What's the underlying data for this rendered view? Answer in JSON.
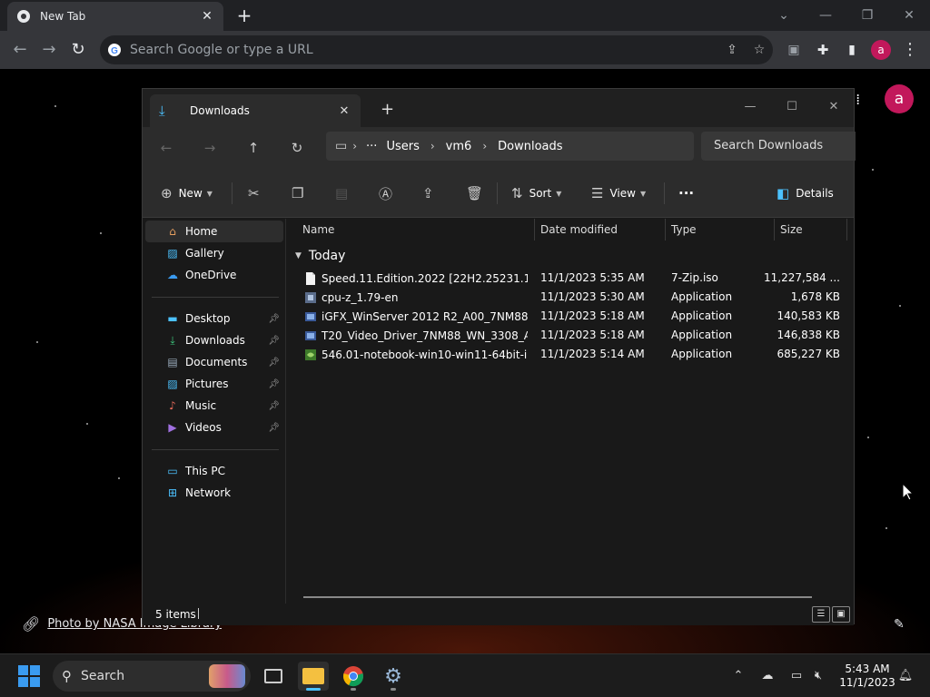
{
  "browser": {
    "tab_title": "New Tab",
    "omnibox_placeholder": "Search Google or type a URL",
    "profile_initial": "a"
  },
  "ntp": {
    "avatar_initial": "a",
    "photo_credit": "Photo by NASA Image Library"
  },
  "explorer": {
    "tab_title": "Downloads",
    "address": [
      "Users",
      "vm6",
      "Downloads"
    ],
    "search_placeholder": "Search Downloads",
    "commands": {
      "new": "New",
      "sort": "Sort",
      "view": "View",
      "more": "···",
      "details": "Details"
    },
    "nav": {
      "group1": [
        {
          "label": "Home",
          "icon": "home-icon",
          "selected": true
        },
        {
          "label": "Gallery",
          "icon": "gallery-icon"
        },
        {
          "label": "OneDrive",
          "icon": "cloud-icon"
        }
      ],
      "group2": [
        {
          "label": "Desktop",
          "icon": "desktop-icon"
        },
        {
          "label": "Downloads",
          "icon": "download-icon"
        },
        {
          "label": "Documents",
          "icon": "document-icon"
        },
        {
          "label": "Pictures",
          "icon": "pictures-icon"
        },
        {
          "label": "Music",
          "icon": "music-icon"
        },
        {
          "label": "Videos",
          "icon": "videos-icon"
        }
      ],
      "group3": [
        {
          "label": "This PC",
          "icon": "pc-icon"
        },
        {
          "label": "Network",
          "icon": "network-icon"
        }
      ]
    },
    "columns": [
      "Name",
      "Date modified",
      "Type",
      "Size"
    ],
    "group_label": "Today",
    "files": [
      {
        "name": "Speed.11.Edition.2022 [22H2.25231.1000]....",
        "date": "11/1/2023 5:35 AM",
        "type": "7-Zip.iso",
        "size": "11,227,584 ...",
        "icon": "file-icon"
      },
      {
        "name": "cpu-z_1.79-en",
        "date": "11/1/2023 5:30 AM",
        "type": "Application",
        "size": "1,678 KB",
        "icon": "cpuz-icon"
      },
      {
        "name": "iGFX_WinServer 2012 R2_A00_7NM88_Set...",
        "date": "11/1/2023 5:18 AM",
        "type": "Application",
        "size": "140,583 KB",
        "icon": "installer-icon"
      },
      {
        "name": "T20_Video_Driver_7NM88_WN_3308_A00",
        "date": "11/1/2023 5:18 AM",
        "type": "Application",
        "size": "146,838 KB",
        "icon": "installer-icon"
      },
      {
        "name": "546.01-notebook-win10-win11-64bit-inte...",
        "date": "11/1/2023 5:14 AM",
        "type": "Application",
        "size": "685,227 KB",
        "icon": "nvidia-icon"
      }
    ],
    "status_items": "5 items"
  },
  "taskbar": {
    "search_label": "Search",
    "clock_time": "5:43 AM",
    "clock_date": "11/1/2023"
  },
  "colors": {
    "accent": "#4cc2ff",
    "profile": "#c2185b",
    "start": "#3a9bf0"
  }
}
